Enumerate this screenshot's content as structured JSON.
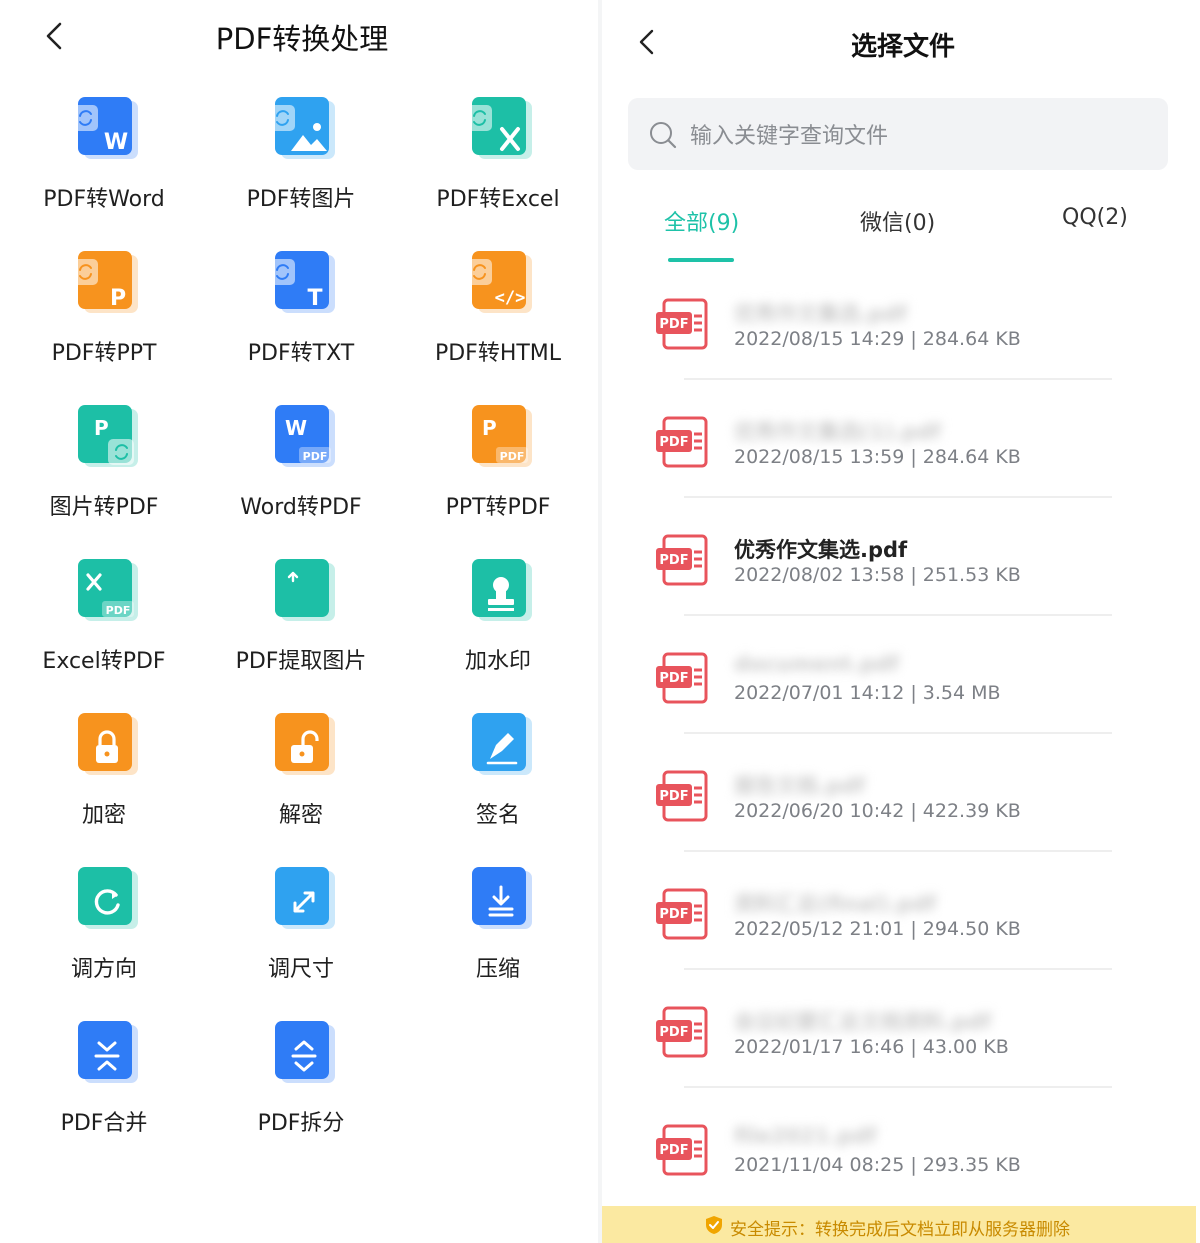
{
  "left": {
    "title": "PDF转换处理",
    "back_icon": "chevron-left-icon",
    "tools": [
      {
        "label": "PDF转Word",
        "icon": "pdf-to-word-icon",
        "color": "#2f7cf6"
      },
      {
        "label": "PDF转图片",
        "icon": "pdf-to-image-icon",
        "color": "#2fa2f0"
      },
      {
        "label": "PDF转Excel",
        "icon": "pdf-to-excel-icon",
        "color": "#1dbfa6"
      },
      {
        "label": "PDF转PPT",
        "icon": "pdf-to-ppt-icon",
        "color": "#f7931e"
      },
      {
        "label": "PDF转TXT",
        "icon": "pdf-to-txt-icon",
        "color": "#2f7cf6"
      },
      {
        "label": "PDF转HTML",
        "icon": "pdf-to-html-icon",
        "color": "#f7931e"
      },
      {
        "label": "图片转PDF",
        "icon": "image-to-pdf-icon",
        "color": "#1dbfa6"
      },
      {
        "label": "Word转PDF",
        "icon": "word-to-pdf-icon",
        "color": "#2f7cf6"
      },
      {
        "label": "PPT转PDF",
        "icon": "ppt-to-pdf-icon",
        "color": "#f7931e"
      },
      {
        "label": "Excel转PDF",
        "icon": "excel-to-pdf-icon",
        "color": "#1dbfa6"
      },
      {
        "label": "PDF提取图片",
        "icon": "extract-image-icon",
        "color": "#1dbfa6"
      },
      {
        "label": "加水印",
        "icon": "watermark-icon",
        "color": "#1dbfa6"
      },
      {
        "label": "加密",
        "icon": "lock-icon",
        "color": "#f7931e"
      },
      {
        "label": "解密",
        "icon": "unlock-icon",
        "color": "#f7931e"
      },
      {
        "label": "签名",
        "icon": "signature-pen-icon",
        "color": "#2fa2f0"
      },
      {
        "label": "调方向",
        "icon": "rotate-icon",
        "color": "#1dbfa6"
      },
      {
        "label": "调尺寸",
        "icon": "resize-icon",
        "color": "#2fa2f0"
      },
      {
        "label": "压缩",
        "icon": "compress-icon",
        "color": "#2f7cf6"
      },
      {
        "label": "PDF合并",
        "icon": "merge-icon",
        "color": "#2f7cf6"
      },
      {
        "label": "PDF拆分",
        "icon": "split-icon",
        "color": "#2f7cf6"
      }
    ]
  },
  "right": {
    "title": "选择文件",
    "back_icon": "chevron-left-icon",
    "search": {
      "placeholder": "输入关键字查询文件",
      "icon": "search-icon"
    },
    "tabs": [
      {
        "label": "全部(9)",
        "active": true
      },
      {
        "label": "微信(0)",
        "active": false
      },
      {
        "label": "QQ(2)",
        "active": false
      }
    ],
    "accent": "#1ec2a8",
    "files": [
      {
        "name": "优秀作文集选.pdf",
        "blurred": true,
        "date": "2022/08/15 14:29",
        "size": "284.64 KB"
      },
      {
        "name": "优秀作文集选(1).pdf",
        "blurred": true,
        "date": "2022/08/15 13:59",
        "size": "284.64 KB"
      },
      {
        "name": "优秀作文集选.pdf",
        "blurred": false,
        "date": "2022/08/02 13:58",
        "size": "251.53 KB"
      },
      {
        "name": "document.pdf",
        "blurred": true,
        "date": "2022/07/01 14:12",
        "size": "3.54 MB"
      },
      {
        "name": "报告文档.pdf",
        "blurred": true,
        "date": "2022/06/20 10:42",
        "size": "422.39 KB"
      },
      {
        "name": "资料汇总(final).pdf",
        "blurred": true,
        "date": "2022/05/12 21:01",
        "size": "294.50 KB"
      },
      {
        "name": "会议纪要汇总文档资料.pdf",
        "blurred": true,
        "date": "2022/01/17 16:46",
        "size": "43.00 KB"
      },
      {
        "name": "file2021.pdf",
        "blurred": true,
        "date": "2021/11/04 08:25",
        "size": "293.35 KB"
      }
    ],
    "notice": {
      "icon": "shield-check-icon",
      "text": "安全提示：转换完成后文档立即从服务器删除"
    }
  }
}
